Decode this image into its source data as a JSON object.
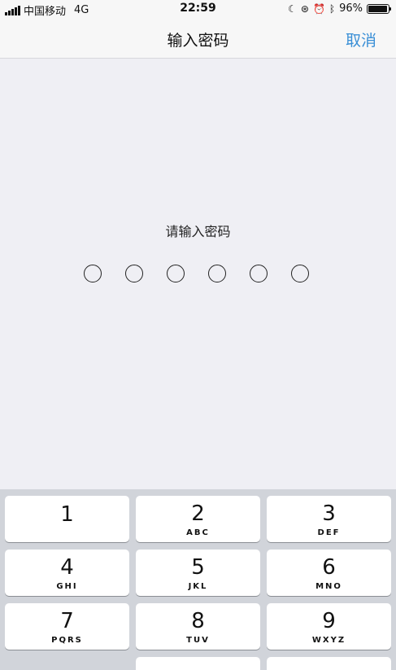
{
  "status_bar": {
    "carrier": "中国移动",
    "network": "4G",
    "time": "22:59",
    "battery_percent": "96%",
    "battery_level": 0.96
  },
  "nav": {
    "title": "输入密码",
    "cancel_label": "取消"
  },
  "prompt": "请输入密码",
  "passcode": {
    "length": 6,
    "filled": 0
  },
  "keypad": {
    "keys": [
      {
        "num": "1",
        "letters": ""
      },
      {
        "num": "2",
        "letters": "ABC"
      },
      {
        "num": "3",
        "letters": "DEF"
      },
      {
        "num": "4",
        "letters": "GHI"
      },
      {
        "num": "5",
        "letters": "JKL"
      },
      {
        "num": "6",
        "letters": "MNO"
      },
      {
        "num": "7",
        "letters": "PQRS"
      },
      {
        "num": "8",
        "letters": "TUV"
      },
      {
        "num": "9",
        "letters": "WXYZ"
      }
    ]
  },
  "colors": {
    "accent": "#3a8fd6",
    "background": "#efeff4",
    "keypad_background": "#d1d4da"
  }
}
